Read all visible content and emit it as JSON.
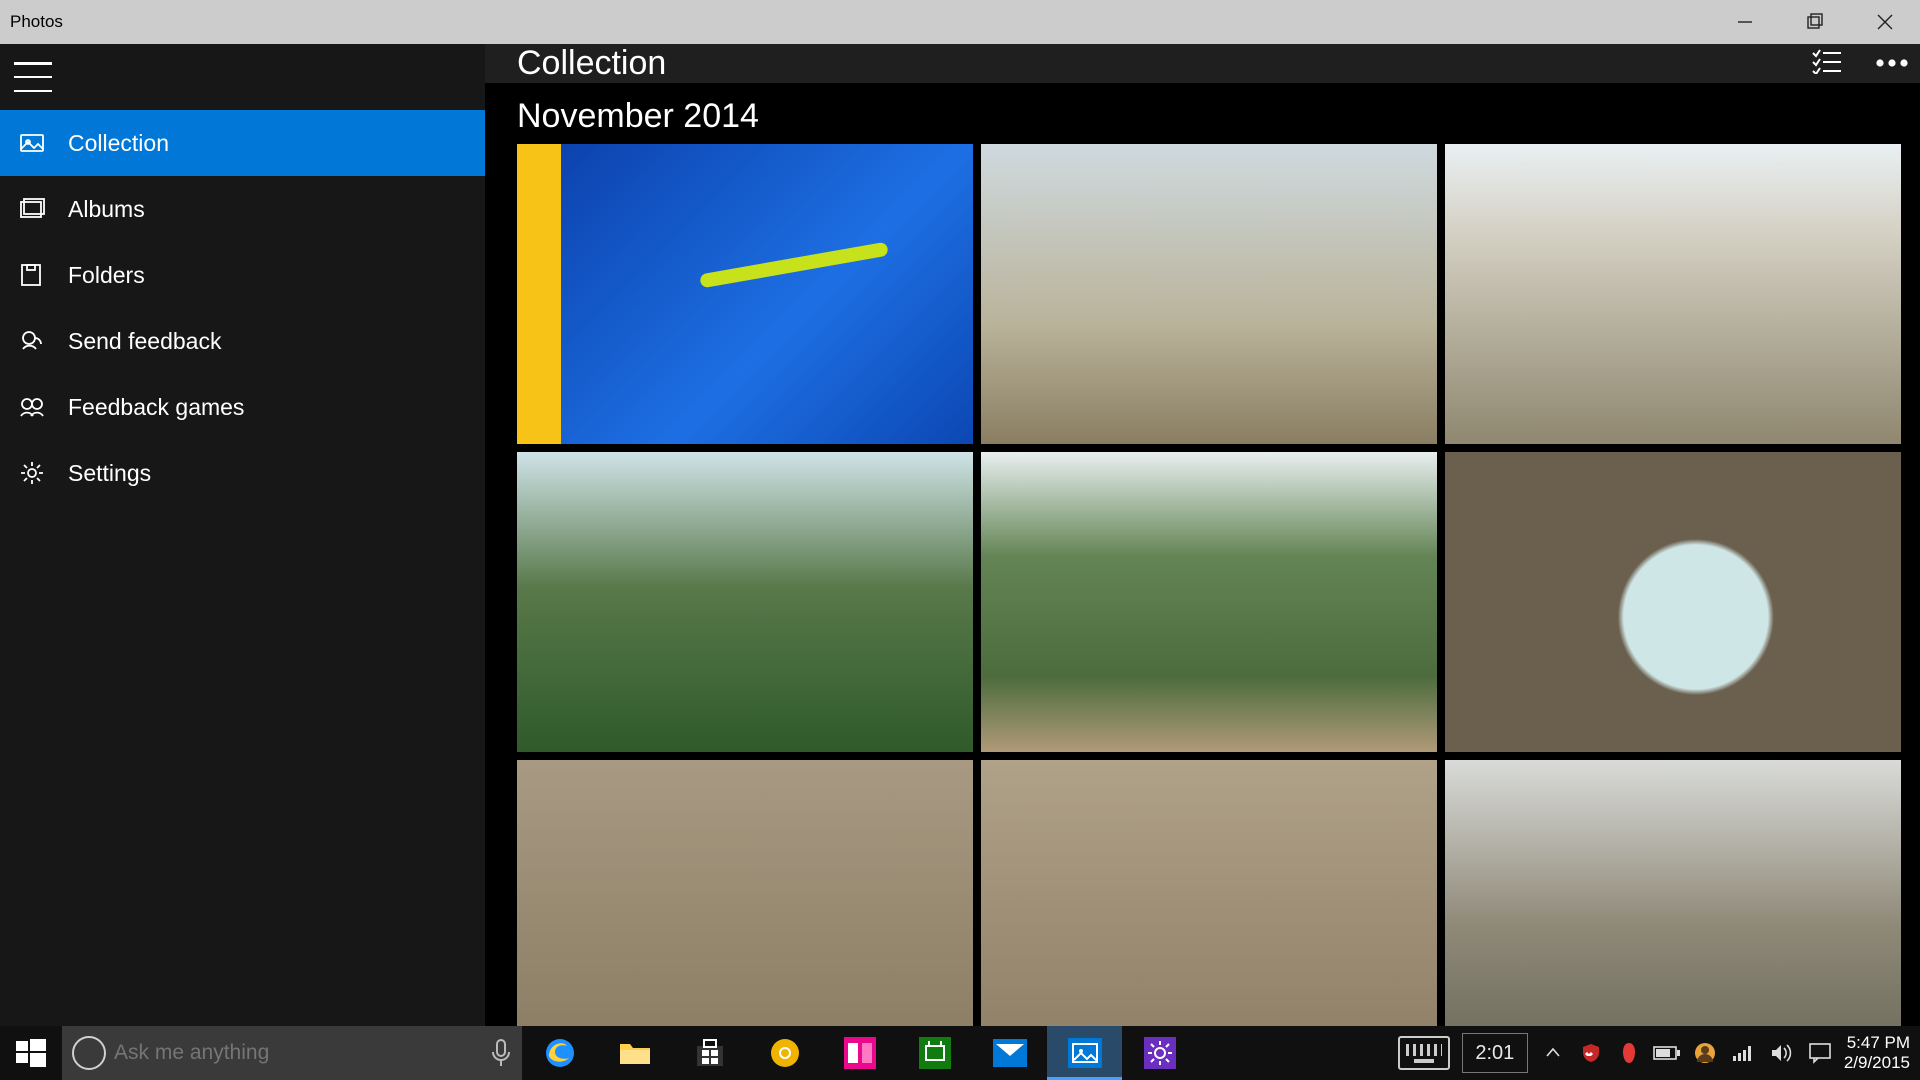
{
  "window": {
    "title": "Photos"
  },
  "sidebar": {
    "items": [
      {
        "label": "Collection",
        "icon": "collection-icon",
        "active": true
      },
      {
        "label": "Albums",
        "icon": "albums-icon"
      },
      {
        "label": "Folders",
        "icon": "folders-icon"
      },
      {
        "label": "Send feedback",
        "icon": "feedback-icon"
      },
      {
        "label": "Feedback games",
        "icon": "feedback-games-icon"
      },
      {
        "label": "Settings",
        "icon": "settings-icon"
      }
    ]
  },
  "header": {
    "title": "Collection"
  },
  "group": {
    "title": "November 2014",
    "photos": [
      {
        "name": "photo-1"
      },
      {
        "name": "photo-2"
      },
      {
        "name": "photo-3"
      },
      {
        "name": "photo-4"
      },
      {
        "name": "photo-5"
      },
      {
        "name": "photo-6"
      },
      {
        "name": "photo-7"
      },
      {
        "name": "photo-8"
      },
      {
        "name": "photo-9"
      }
    ]
  },
  "search": {
    "placeholder": "Ask me anything"
  },
  "taskbar": {
    "pins": [
      {
        "name": "edge"
      },
      {
        "name": "file-explorer"
      },
      {
        "name": "store"
      },
      {
        "name": "chrome-canary"
      },
      {
        "name": "app-pink"
      },
      {
        "name": "xbox"
      },
      {
        "name": "mail"
      },
      {
        "name": "photos",
        "active": true
      },
      {
        "name": "settings-app"
      }
    ],
    "timer": "2:01"
  },
  "clock": {
    "time": "5:47 PM",
    "date": "2/9/2015"
  }
}
